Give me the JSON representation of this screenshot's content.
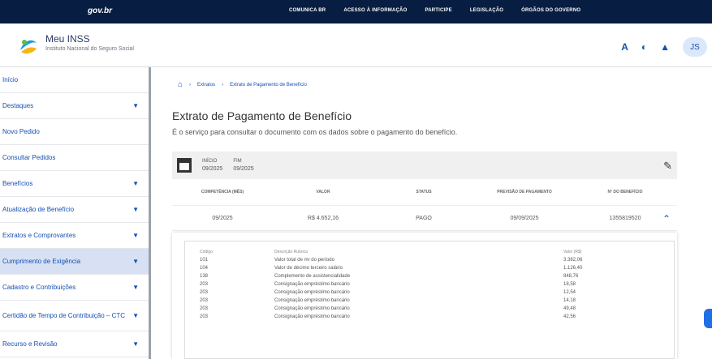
{
  "gov_bar": {
    "logo": "gov.br",
    "links": [
      "COMUNICA BR",
      "ACESSO À INFORMAÇÃO",
      "PARTICIPE",
      "LEGISLAÇÃO",
      "ÓRGÃOS DO GOVERNO"
    ]
  },
  "app_header": {
    "name": "Meu INSS",
    "subtitle": "Instituto Nacional do Seguro Social",
    "tools": [
      "A",
      "◐",
      "▲"
    ],
    "avatar": "JS"
  },
  "sidebar": {
    "items": [
      {
        "label": "Início",
        "chevron": ""
      },
      {
        "label": "Destaques",
        "chevron": "▼"
      },
      {
        "label": "Novo Pedido",
        "chevron": ""
      },
      {
        "label": "Consultar Pedidos",
        "chevron": ""
      },
      {
        "label": "Benefícios",
        "chevron": "▼"
      },
      {
        "label": "Atualização de Benefício",
        "chevron": "▼"
      },
      {
        "label": "Extratos e Comprovantes",
        "chevron": "▼"
      },
      {
        "label": "Cumprimento de Exigência",
        "chevron": "▼"
      },
      {
        "label": "Cadastro e Contribuições",
        "chevron": "▼"
      },
      {
        "label": "Certidão de Tempo de Contribuição – CTC",
        "chevron": "▼"
      },
      {
        "label": "Recurso e Revisão",
        "chevron": "▼"
      }
    ]
  },
  "main": {
    "breadcrumb": [
      "Extratos",
      "Extrato de Pagamento de Benefício"
    ],
    "title": "Extrato de Pagamento de Benefício",
    "description": "É o serviço para consultar o documento com os dados sobre o pagamento do benefício.",
    "period": {
      "start_label": "INÍCIO",
      "start_value": "09/2025",
      "end_label": "FIM",
      "end_value": "09/2025"
    },
    "columns": [
      "COMPETÊNCIA (MÊS)",
      "VALOR",
      "STATUS",
      "PREVISÃO DE PAGAMENTO",
      "Nº DO BENEFÍCIO"
    ],
    "row": {
      "competencia": "09/2025",
      "valor": "R$ 4.652,16",
      "status": "PAGO",
      "previsao": "09/09/2025",
      "beneficio": "1355819520"
    },
    "detail": {
      "headers": [
        "Código",
        "Descrição Rubrica",
        "Valor (R$)"
      ],
      "rows": [
        {
          "code": "101",
          "desc": "Valor total de mr do período",
          "value": "3.382,06"
        },
        {
          "code": "104",
          "desc": "Valor de décimo terceiro salário",
          "value": "1.126,40"
        },
        {
          "code": "138",
          "desc": "Complemento de assistencialidade",
          "value": "848,76"
        },
        {
          "code": "203",
          "desc": "Consignação empréstimo bancário",
          "value": "18,58"
        },
        {
          "code": "203",
          "desc": "Consignação empréstimo bancário",
          "value": "12,54"
        },
        {
          "code": "203",
          "desc": "Consignação empréstimo bancário",
          "value": "14,18"
        },
        {
          "code": "203",
          "desc": "Consignação empréstimo bancário",
          "value": "49,48"
        },
        {
          "code": "203",
          "desc": "Consignação empréstimo bancário",
          "value": "42,56"
        }
      ]
    }
  }
}
